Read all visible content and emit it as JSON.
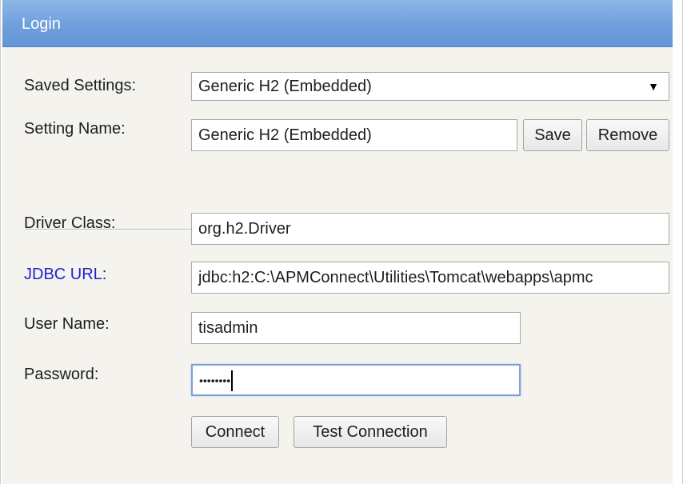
{
  "window": {
    "title": "Login"
  },
  "saved_settings": {
    "label": "Saved Settings:",
    "selected": "Generic H2 (Embedded)",
    "arrow": "▼"
  },
  "setting_name": {
    "label": "Setting Name:",
    "value": "Generic H2 (Embedded)",
    "save_label": "Save",
    "remove_label": "Remove"
  },
  "driver_class": {
    "label": "Driver Class:",
    "value": "org.h2.Driver"
  },
  "jdbc_url": {
    "label": "JDBC URL",
    "label_suffix": ":",
    "value": "jdbc:h2:C:\\APMConnect\\Utilities\\Tomcat\\webapps\\apmc"
  },
  "user_name": {
    "label": "User Name:",
    "value": "tisadmin"
  },
  "password": {
    "label": "Password:",
    "masked_value": "••••••••"
  },
  "actions": {
    "connect_label": "Connect",
    "test_label": "Test Connection"
  },
  "colors": {
    "title_bar": "#6f9fdc",
    "panel_bg": "#f5f3ee",
    "link_label": "#2222cc",
    "focus_border": "#7fa0d8"
  }
}
